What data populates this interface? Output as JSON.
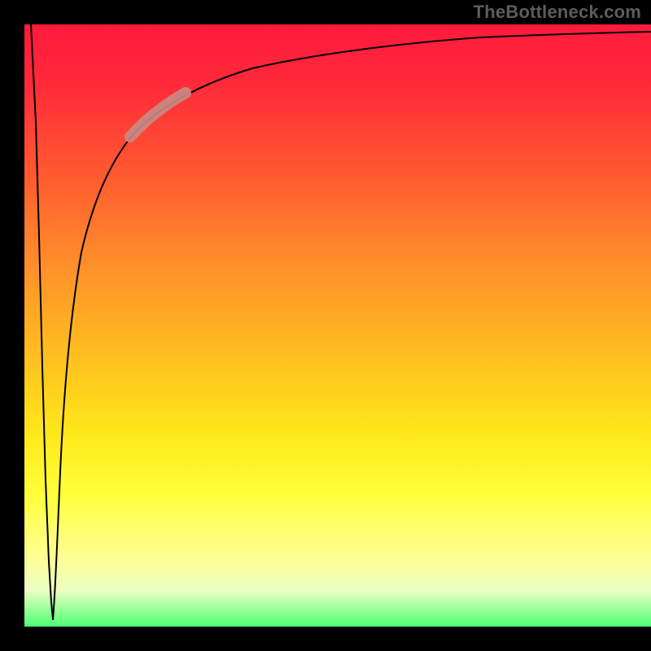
{
  "watermark": "TheBottleneck.com",
  "colors": {
    "curve_stroke": "#000000",
    "highlight_stroke": "#c98b84",
    "bg_black": "#000000"
  },
  "chart_data": {
    "type": "line",
    "title": "",
    "xlabel": "",
    "ylabel": "",
    "xlim": [
      0,
      100
    ],
    "ylim": [
      0,
      100
    ],
    "grid": false,
    "series": [
      {
        "name": "left-descent",
        "x": [
          0,
          0.4,
          0.8,
          1.2,
          1.6,
          2.0,
          2.4,
          2.8,
          3.2,
          3.6,
          4.0
        ],
        "values": [
          100,
          90,
          80,
          70,
          60,
          50,
          40,
          30,
          20,
          10,
          1
        ]
      },
      {
        "name": "main-curve",
        "x": [
          4.0,
          4.4,
          4.8,
          5.5,
          7,
          9,
          12,
          16,
          20,
          25,
          32,
          40,
          50,
          62,
          75,
          88,
          100
        ],
        "values": [
          1,
          10,
          20,
          35,
          50,
          62,
          72,
          80,
          84,
          88,
          91,
          93,
          95,
          96.5,
          97.5,
          98.2,
          98.7
        ]
      },
      {
        "name": "highlight-segment",
        "x": [
          16,
          18,
          20,
          22,
          24,
          26,
          28
        ],
        "values": [
          80,
          82,
          84,
          85.5,
          87,
          88,
          89
        ]
      }
    ],
    "annotations": []
  }
}
